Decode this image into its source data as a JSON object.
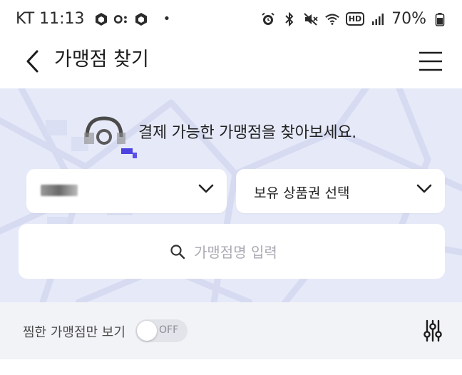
{
  "status_bar": {
    "carrier_time": "KT 11:13",
    "battery": "70%",
    "left_icons": [
      "app-notification-icon",
      "link-icon",
      "app-notification-icon"
    ],
    "right_icons": [
      "alarm-icon",
      "bluetooth-icon",
      "mute-icon",
      "wifi-icon",
      "hd-icon",
      "signal-icon",
      "battery-icon"
    ],
    "hd_label": "HD",
    "dot": "•"
  },
  "header": {
    "title": "가맹점 찾기",
    "back_icon": "chevron-left-icon",
    "menu_icon": "hamburger-menu-icon"
  },
  "hero": {
    "headline": "결제 가능한 가맹점을 찾아보세요.",
    "pin_icon": "location-pin-icon"
  },
  "selectors": {
    "region_value": "",
    "voucher_label": "보유 상품권 선택"
  },
  "search": {
    "placeholder": "가맹점명 입력",
    "icon": "search-icon"
  },
  "filter_bar": {
    "favorites_label": "찜한 가맹점만 보기",
    "toggle_state": "OFF",
    "filter_icon": "sliders-icon"
  },
  "colors": {
    "hero_bg": "#e6e9f8",
    "filter_bar_bg": "#f2f3f7",
    "accent": "#5b50e8",
    "placeholder": "#a9aab3"
  }
}
